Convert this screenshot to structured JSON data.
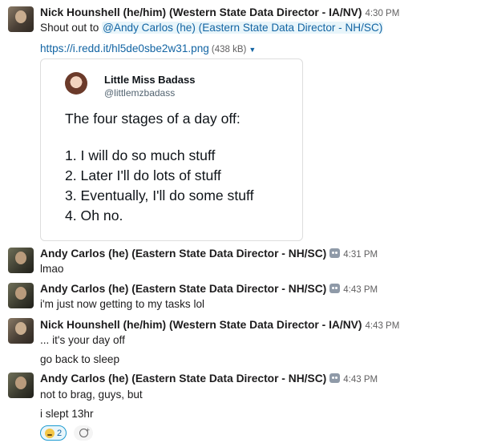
{
  "messages": [
    {
      "author": "Nick Hounshell (he/him) (Western State Data Director - IA/NV)",
      "time": "4:30 PM",
      "text_prefix": "Shout out to ",
      "mention": "@Andy Carlos (he) (Eastern State Data Director - NH/SC)",
      "attachment": {
        "url": "https://i.redd.it/hl5de0sbe2w31.png",
        "size": "(438 kB)"
      }
    },
    {
      "author": "Andy Carlos (he) (Eastern State Data Director - NH/SC)",
      "time": "4:31 PM",
      "text": "lmao"
    },
    {
      "author": "Andy Carlos (he) (Eastern State Data Director - NH/SC)",
      "time": "4:43 PM",
      "text": "i'm just now getting to my tasks lol"
    },
    {
      "author": "Nick Hounshell (he/him) (Western State Data Director - IA/NV)",
      "time": "4:43 PM",
      "text": "... it's your day off",
      "text2": "go back to sleep"
    },
    {
      "author": "Andy Carlos (he) (Eastern State Data Director - NH/SC)",
      "time": "4:43 PM",
      "text": "not to brag, guys, but",
      "text2": "i slept 13hr",
      "reaction": {
        "emoji": "sleepy-face",
        "count": "2"
      }
    }
  ],
  "tweet": {
    "name": "Little Miss Badass",
    "handle": "@littlemzbadass",
    "lines": [
      "The four stages of a day off:",
      "1. I will do so much stuff",
      "2. Later I'll do lots of stuff",
      "3. Eventually, I'll do some stuff",
      "4. Oh no."
    ]
  }
}
